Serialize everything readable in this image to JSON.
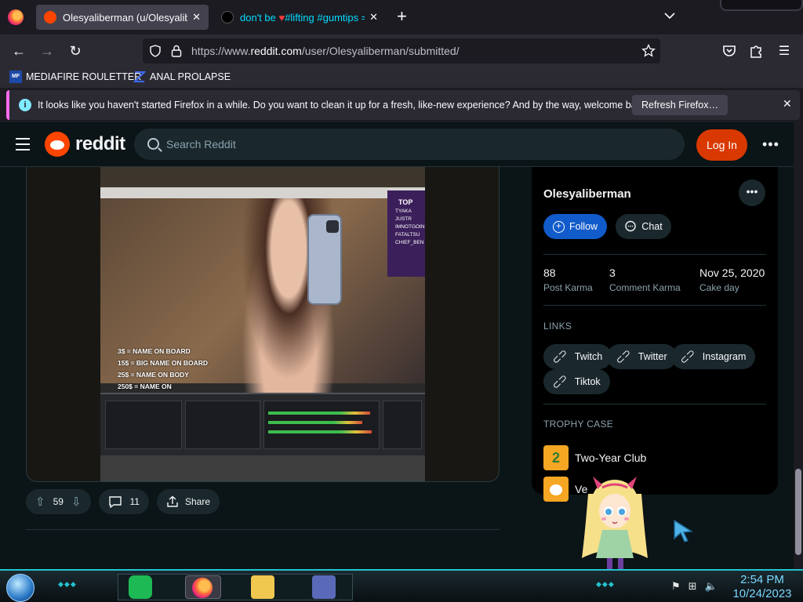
{
  "browser": {
    "tabs": [
      {
        "title": "Olesyaliberman (u/Olesyaliberm",
        "active": true
      },
      {
        "title_prefix": "don't be ",
        "title_suffix": "#lifting #gumtips =",
        "active": false
      }
    ],
    "url_prefix": "https://www.",
    "url_domain": "reddit.com",
    "url_path": "/user/Olesyaliberman/submitted/",
    "bookmarks": [
      "MEDIAFIRE ROULETTER",
      "ANAL PROLAPSE"
    ],
    "bookmark_icon_text": "MF",
    "notification": {
      "message": "It looks like you haven't started Firefox in a while. Do you want to clean it up for a fresh, like-new experience? And by the way, welcome back!",
      "button": "Refresh Firefox…"
    }
  },
  "reddit": {
    "brand": "reddit",
    "search_placeholder": "Search Reddit",
    "login_label": "Log In",
    "post": {
      "overlay_prices": [
        "3$ = NAME ON BOARD",
        "15$ = BIG NAME ON BOARD",
        "25$ = NAME ON BODY",
        "250$ = NAME ON"
      ],
      "chat_header": "TOP",
      "chat_names": [
        "TYAKA",
        "JUSTR",
        "IMNOTGOIN",
        "FATALTSU",
        "CHIEF_BEN"
      ],
      "votes": "59",
      "comments": "11",
      "share_label": "Share"
    },
    "profile": {
      "username": "Olesyaliberman",
      "follow_label": "Follow",
      "chat_label": "Chat",
      "stats": [
        {
          "value": "88",
          "label": "Post Karma"
        },
        {
          "value": "3",
          "label": "Comment Karma"
        },
        {
          "value": "Nov 25, 2020",
          "label": "Cake day"
        }
      ],
      "links_heading": "LINKS",
      "links": [
        "Twitch",
        "Twitter",
        "Instagram",
        "Tiktok"
      ],
      "trophy_heading": "TROPHY CASE",
      "trophies": [
        "Two-Year Club",
        "Ve"
      ]
    }
  },
  "taskbar": {
    "time": "2:54 PM",
    "date": "10/24/2023"
  },
  "colors": {
    "reddit_orange": "#ff4500",
    "login_bg": "#d93900",
    "follow_bg": "#115bca",
    "tiktok_tab_text": "#00ddff",
    "clock": "#7ad7ff"
  }
}
